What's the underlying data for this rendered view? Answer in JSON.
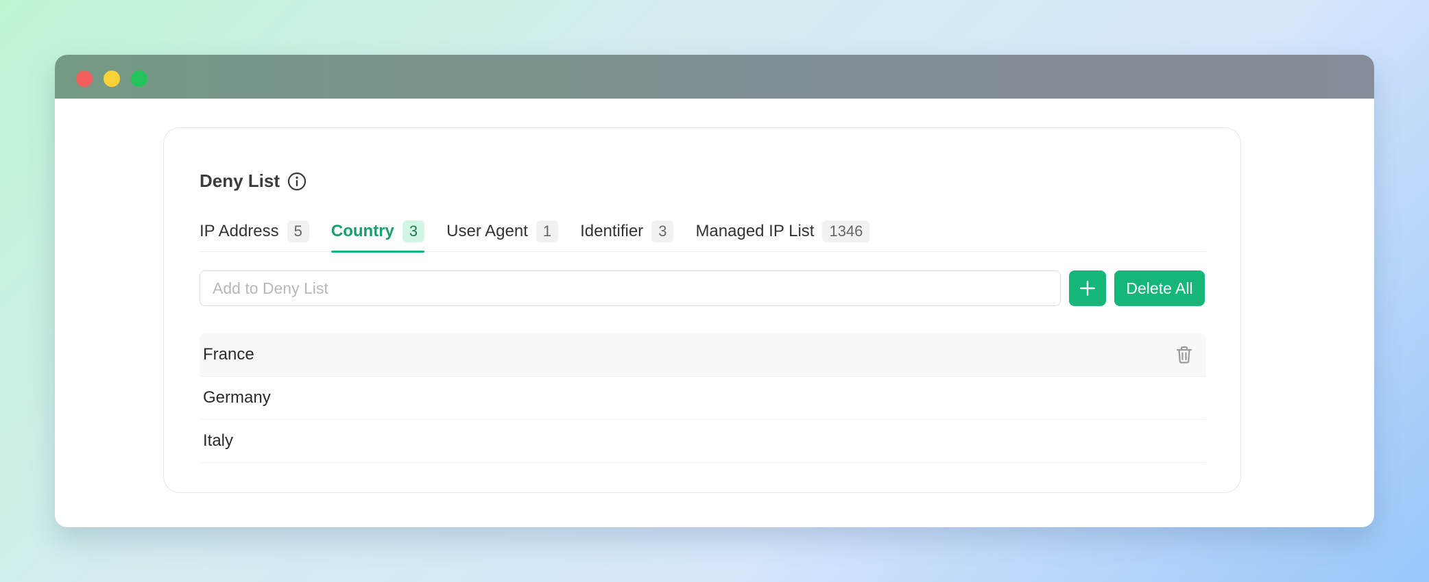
{
  "window": {
    "controls": [
      "close",
      "minimize",
      "maximize"
    ]
  },
  "card": {
    "title": "Deny List",
    "title_icon": "info-icon"
  },
  "tabs": [
    {
      "label": "IP Address",
      "count": "5",
      "active": false
    },
    {
      "label": "Country",
      "count": "3",
      "active": true
    },
    {
      "label": "User Agent",
      "count": "1",
      "active": false
    },
    {
      "label": "Identifier",
      "count": "3",
      "active": false
    },
    {
      "label": "Managed IP List",
      "count": "1346",
      "active": false
    }
  ],
  "add": {
    "placeholder": "Add to Deny List",
    "value": "",
    "plus_icon": "plus-icon",
    "delete_all_label": "Delete All"
  },
  "items": [
    {
      "label": "France",
      "action_icon": "trash-icon"
    },
    {
      "label": "Germany",
      "action_icon": "trash-icon"
    },
    {
      "label": "Italy",
      "action_icon": "trash-icon"
    }
  ],
  "colors": {
    "accent": "#16b57a",
    "active_tab_text": "#16a06b",
    "close": "#f25f5c",
    "minimize": "#f9d236",
    "maximize": "#22c35a"
  }
}
